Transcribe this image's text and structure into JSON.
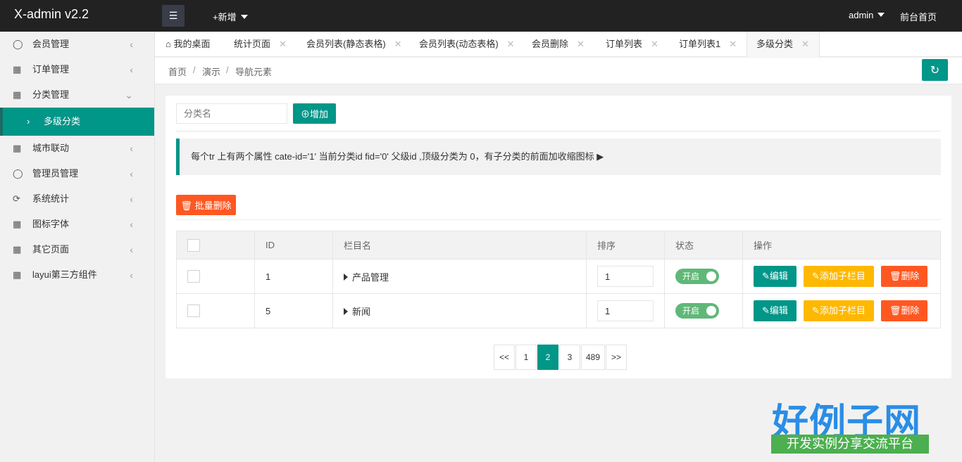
{
  "header": {
    "logo": "X-admin v2.2",
    "menu_icon": "hamburger-icon",
    "new_label": "+新增",
    "admin_label": "admin",
    "front_label": "前台首页"
  },
  "sidebar": {
    "items": [
      {
        "label": "会员管理",
        "icon": "user-icon"
      },
      {
        "label": "订单管理",
        "icon": "order-icon"
      },
      {
        "label": "分类管理",
        "icon": "category-icon",
        "expanded": true
      },
      {
        "label": "城市联动",
        "icon": "city-icon"
      },
      {
        "label": "管理员管理",
        "icon": "admin-icon"
      },
      {
        "label": "系统统计",
        "icon": "stats-icon"
      },
      {
        "label": "图标字体",
        "icon": "grid-icon"
      },
      {
        "label": "其它页面",
        "icon": "grid-icon"
      },
      {
        "label": "layui第三方组件",
        "icon": "grid-icon"
      }
    ],
    "sub_active": "多级分类"
  },
  "tabs": [
    {
      "label": "我的桌面",
      "icon": "home-icon"
    },
    {
      "label": "统计页面"
    },
    {
      "label": "会员列表(静态表格)"
    },
    {
      "label": "会员列表(动态表格)"
    },
    {
      "label": "会员删除"
    },
    {
      "label": "订单列表"
    },
    {
      "label": "订单列表1"
    },
    {
      "label": "多级分类",
      "active": true
    }
  ],
  "breadcrumb": [
    "首页",
    "演示",
    "导航元素"
  ],
  "form": {
    "placeholder": "分类名",
    "add_label": "增加"
  },
  "notice": "每个tr 上有两个属性 cate-id='1' 当前分类id fid='0' 父级id ,顶级分类为 0，有子分类的前面加收缩图标",
  "batch_delete": "批量删除",
  "table": {
    "headers": [
      "",
      "ID",
      "栏目名",
      "排序",
      "状态",
      "操作"
    ],
    "rows": [
      {
        "id": "1",
        "name": "产品管理",
        "sort": "1",
        "status": "开启"
      },
      {
        "id": "5",
        "name": "新闻",
        "sort": "1",
        "status": "开启"
      }
    ],
    "op_edit": "编辑",
    "op_add_sub": "添加子栏目",
    "op_delete": "删除"
  },
  "pager": [
    "<<",
    "1",
    "2",
    "3",
    "489",
    ">>"
  ],
  "pager_current": "2",
  "watermark": {
    "big": "好例子网",
    "small": "开发实例分享交流平台"
  },
  "colors": {
    "primary": "#009688",
    "danger": "#FF5722",
    "warn": "#FFB800",
    "switch_on": "#5FB878"
  }
}
